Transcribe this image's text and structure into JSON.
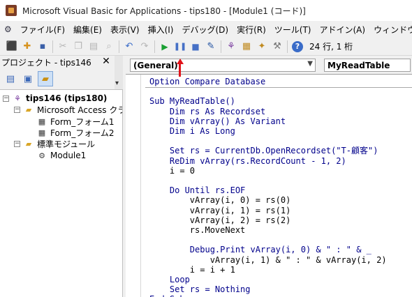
{
  "title": {
    "text": "Microsoft Visual Basic for Applications - tips180 - [Module1 (コード)]"
  },
  "menu": {
    "items": [
      "ファイル(F)",
      "編集(E)",
      "表示(V)",
      "挿入(I)",
      "デバッグ(D)",
      "実行(R)",
      "ツール(T)",
      "アドイン(A)",
      "ウィンドウ(W)"
    ]
  },
  "toolbar": {
    "cursor_position": "24 行, 1 桁",
    "help_label": "?"
  },
  "project": {
    "header": "プロジェクト - tips146",
    "close_label": "✕",
    "tree": {
      "root": "tips146 (tips180)",
      "access_folder": "Microsoft Access クラ",
      "forms": [
        "Form_フォーム1",
        "Form_フォーム2"
      ],
      "std_folder": "標準モジュール",
      "modules": [
        "Module1"
      ]
    }
  },
  "code": {
    "object_combo": "(General)",
    "procedure_combo": "MyReadTable",
    "lines": [
      "Option Compare Database",
      "",
      "Sub MyReadTable()",
      "    Dim rs As Recordset",
      "    Dim vArray() As Variant",
      "    Dim i As Long",
      "",
      "    Set rs = CurrentDb.OpenRecordset(\"T-顧客\")",
      "    ReDim vArray(rs.RecordCount - 1, 2)",
      "    i = 0",
      "",
      "    Do Until rs.EOF",
      "        vArray(i, 0) = rs(0)",
      "        vArray(i, 1) = rs(1)",
      "        vArray(i, 2) = rs(2)",
      "        rs.MoveNext",
      "",
      "        Debug.Print vArray(i, 0) & \" : \" & _",
      "            vArray(i, 1) & \" : \" & vArray(i, 2)",
      "        i = i + 1",
      "    Loop",
      "    Set rs = Nothing",
      "End Sub"
    ]
  },
  "colors": {
    "keyword": "#00008b",
    "annotation_arrow": "#e0131a",
    "run_button": "#1aa033"
  }
}
